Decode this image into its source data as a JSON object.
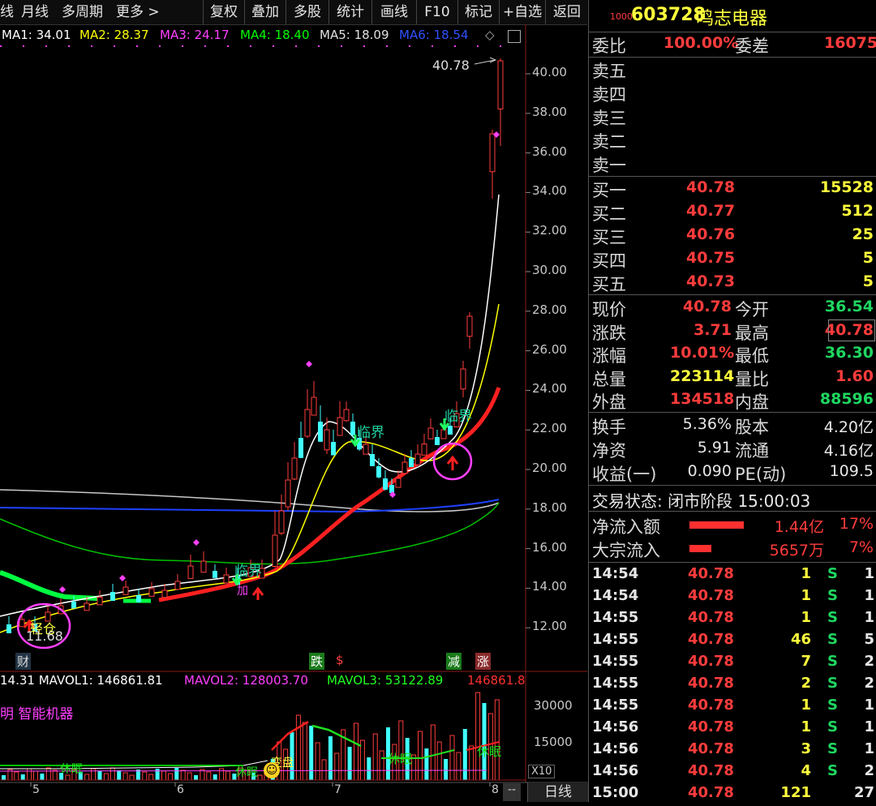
{
  "toolbar": {
    "items": [
      "线",
      "月线",
      "多周期",
      "更多 >"
    ],
    "buttons": [
      "复权",
      "叠加",
      "多股",
      "统计",
      "画线",
      "F10",
      "标记",
      "+自选",
      "返回"
    ]
  },
  "ma_line": {
    "ma1": "MA1: 34.01",
    "ma2": "MA2: 28.37",
    "ma3": "MA3: 24.17",
    "ma4": "MA4: 18.40",
    "ma5": "MA5: 18.09",
    "ma6": "MA6: 18.54",
    "diamond": "◇"
  },
  "price_axis": [
    "40.00",
    "38.00",
    "36.00",
    "34.00",
    "32.00",
    "30.00",
    "28.00",
    "26.00",
    "24.00",
    "22.00",
    "20.00",
    "18.00",
    "16.00",
    "14.00",
    "12.00"
  ],
  "chart_annotations": {
    "high_price": "40.78",
    "low_price": "11.68",
    "light_position": "轻仓",
    "critical1": "临界",
    "critical2": "临界",
    "critical3": "临界",
    "critical_small": "加",
    "fall": "跌",
    "dollar": "$",
    "reduce": "减",
    "limit_up": "涨",
    "wealth": "财"
  },
  "volume": {
    "mavol_line": "14.31  MAVOL1: 146861.81",
    "mavol2": "MAVOL2: 128003.70",
    "mavol3": "MAVOL3: 53122.89",
    "mavol4": "146861.8",
    "indicator_name": "明 智能机器",
    "axis": [
      "30000",
      "15000"
    ],
    "x10": "X10",
    "sleep1": "休眠",
    "sleep2": "休眠",
    "sleep3": "休眠",
    "sleep4": "休眠",
    "change_sell": "变盘"
  },
  "x_axis": [
    "5",
    "6",
    "7",
    "8"
  ],
  "period_tab": "日线",
  "stock": {
    "prefix": "1000",
    "code": "603728",
    "name": "鸣志电器"
  },
  "order_ratio": {
    "label1": "委比",
    "value1": "100.00%",
    "label2": "委差",
    "value2": "16075"
  },
  "sells": [
    "卖五",
    "卖四",
    "卖三",
    "卖二",
    "卖一"
  ],
  "buys": [
    {
      "label": "买一",
      "price": "40.78",
      "vol": "15528"
    },
    {
      "label": "买二",
      "price": "40.77",
      "vol": "512"
    },
    {
      "label": "买三",
      "price": "40.76",
      "vol": "25"
    },
    {
      "label": "买四",
      "price": "40.75",
      "vol": "5"
    },
    {
      "label": "买五",
      "price": "40.73",
      "vol": "5"
    }
  ],
  "quote": [
    {
      "l1": "现价",
      "v1": "40.78",
      "l2": "今开",
      "v2": "36.54"
    },
    {
      "l1": "涨跌",
      "v1": "3.71",
      "l2": "最高",
      "v2": "40.78"
    },
    {
      "l1": "涨幅",
      "v1": "10.01%",
      "l2": "最低",
      "v2": "36.30"
    },
    {
      "l1": "总量",
      "v1": "223114",
      "l2": "量比",
      "v2": "1.60"
    },
    {
      "l1": "外盘",
      "v1": "134518",
      "l2": "内盘",
      "v2": "88596"
    }
  ],
  "fundamentals": [
    {
      "l1": "换手",
      "v1": "5.36%",
      "l2": "股本",
      "v2": "4.20亿"
    },
    {
      "l1": "净资",
      "v1": "5.91",
      "l2": "流通",
      "v2": "4.16亿"
    },
    {
      "l1": "收益(一)",
      "v1": "0.090",
      "l2": "PE(动)",
      "v2": "109.5"
    }
  ],
  "trade_status": "交易状态: 闭市阶段 15:00:03",
  "flows": [
    {
      "label": "净流入额",
      "value": "1.44亿",
      "pct": "17%",
      "fill": 0.88
    },
    {
      "label": "大宗流入",
      "value": "5657万",
      "pct": "7%",
      "fill": 0.35
    }
  ],
  "ticks": [
    {
      "t": "14:54",
      "p": "40.78",
      "v": "1",
      "s": "S",
      "n": "1"
    },
    {
      "t": "14:54",
      "p": "40.78",
      "v": "1",
      "s": "S",
      "n": "1"
    },
    {
      "t": "14:55",
      "p": "40.78",
      "v": "1",
      "s": "S",
      "n": "1"
    },
    {
      "t": "14:55",
      "p": "40.78",
      "v": "46",
      "s": "S",
      "n": "5"
    },
    {
      "t": "14:55",
      "p": "40.78",
      "v": "7",
      "s": "S",
      "n": "2"
    },
    {
      "t": "14:55",
      "p": "40.78",
      "v": "2",
      "s": "S",
      "n": "2"
    },
    {
      "t": "14:55",
      "p": "40.78",
      "v": "1",
      "s": "S",
      "n": "1"
    },
    {
      "t": "14:56",
      "p": "40.78",
      "v": "1",
      "s": "S",
      "n": "1"
    },
    {
      "t": "14:56",
      "p": "40.78",
      "v": "3",
      "s": "S",
      "n": "1"
    },
    {
      "t": "14:56",
      "p": "40.78",
      "v": "4",
      "s": "S",
      "n": "2"
    },
    {
      "t": "15:00",
      "p": "40.78",
      "v": "121",
      "s": "",
      "n": "27"
    }
  ],
  "colors": {
    "up": "#ff3c3c",
    "down": "#00ffff",
    "bg": "#000000",
    "ma_white": "#ffffff",
    "ma_yellow": "#ffff00",
    "ma_red": "#ff2020",
    "ma_green": "#00c800",
    "ma_blue": "#2040ff",
    "ma_gray": "#c0c0c0"
  }
}
